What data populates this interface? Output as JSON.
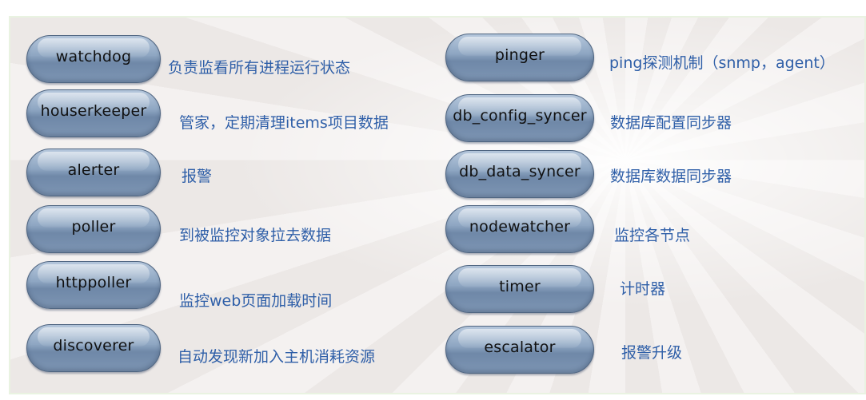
{
  "components": {
    "left": [
      {
        "name": "watchdog",
        "desc": "负责监看所有进程运行状态"
      },
      {
        "name": "houserkeeper",
        "desc": "管家，定期清理items项目数据"
      },
      {
        "name": "alerter",
        "desc": "报警"
      },
      {
        "name": "poller",
        "desc": "到被监控对象拉去数据"
      },
      {
        "name": "httppoller",
        "desc": "监控web页面加载时间"
      },
      {
        "name": "discoverer",
        "desc": "自动发现新加入主机消耗资源"
      }
    ],
    "right": [
      {
        "name": "pinger",
        "desc": "ping探测机制（snmp，agent）"
      },
      {
        "name": "db_config_syncer",
        "desc": "数据库配置同步器"
      },
      {
        "name": "db_data_syncer",
        "desc": "数据库数据同步器"
      },
      {
        "name": "nodewatcher",
        "desc": "监控各节点"
      },
      {
        "name": "timer",
        "desc": "计时器"
      },
      {
        "name": "escalator",
        "desc": "报警升级"
      }
    ]
  }
}
